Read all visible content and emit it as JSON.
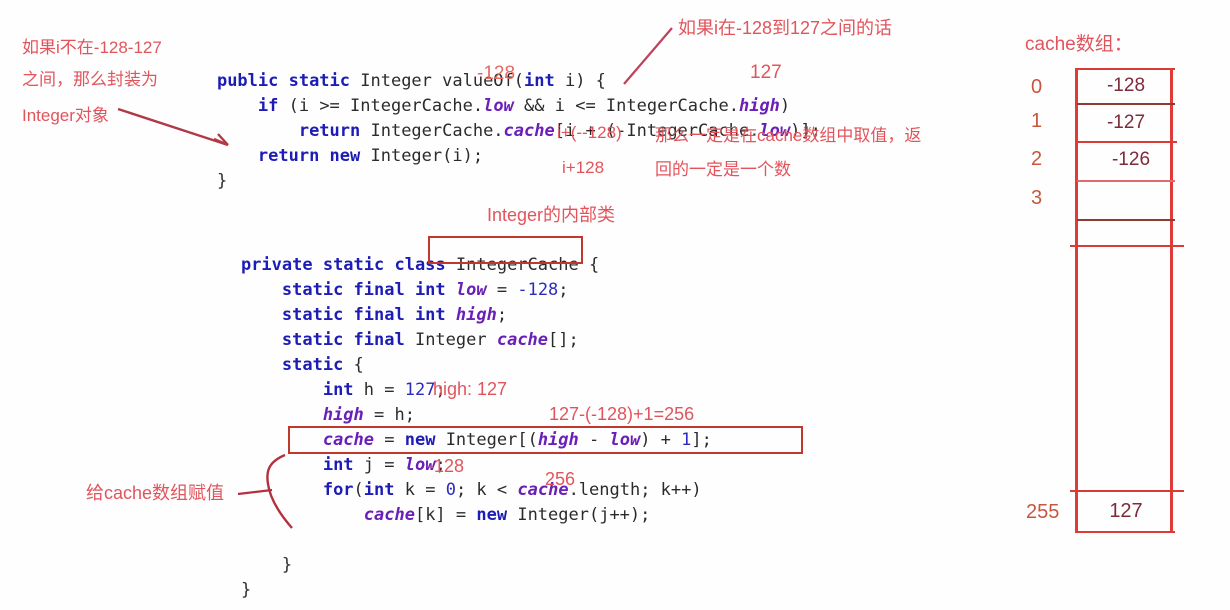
{
  "code_top": {
    "lines": [
      [
        {
          "t": "    ",
          "c": "plain"
        },
        {
          "t": "public static ",
          "c": "kw"
        },
        {
          "t": "Integer valueOf(",
          "c": "plain"
        },
        {
          "t": "int",
          "c": "kw"
        },
        {
          "t": " i) {",
          "c": "plain"
        }
      ],
      [
        {
          "t": "        ",
          "c": "plain"
        },
        {
          "t": "if",
          "c": "kw"
        },
        {
          "t": " (i >= IntegerCache.",
          "c": "plain"
        },
        {
          "t": "low",
          "c": "field"
        },
        {
          "t": " && i <= IntegerCache.",
          "c": "plain"
        },
        {
          "t": "high",
          "c": "field"
        },
        {
          "t": ")",
          "c": "plain"
        }
      ],
      [
        {
          "t": "            ",
          "c": "plain"
        },
        {
          "t": "return",
          "c": "kw"
        },
        {
          "t": " IntegerCache.",
          "c": "plain"
        },
        {
          "t": "cache",
          "c": "field"
        },
        {
          "t": "[i + (-IntegerCache.",
          "c": "plain"
        },
        {
          "t": "low",
          "c": "field"
        },
        {
          "t": ")];",
          "c": "plain"
        }
      ],
      [
        {
          "t": "        ",
          "c": "plain"
        },
        {
          "t": "return new",
          "c": "kw"
        },
        {
          "t": " Integer(i);",
          "c": "plain"
        }
      ],
      [
        {
          "t": "    }",
          "c": "plain"
        }
      ]
    ]
  },
  "code_middle": {
    "lines": [
      [
        {
          "t": "    ",
          "c": "plain"
        },
        {
          "t": "private static class",
          "c": "kw"
        },
        {
          "t": " IntegerCache {",
          "c": "plain"
        }
      ],
      [
        {
          "t": "        ",
          "c": "plain"
        },
        {
          "t": "static final int",
          "c": "kw"
        },
        {
          "t": " ",
          "c": "plain"
        },
        {
          "t": "low",
          "c": "field"
        },
        {
          "t": " = ",
          "c": "plain"
        },
        {
          "t": "-128",
          "c": "num"
        },
        {
          "t": ";",
          "c": "plain"
        }
      ],
      [
        {
          "t": "        ",
          "c": "plain"
        },
        {
          "t": "static final int",
          "c": "kw"
        },
        {
          "t": " ",
          "c": "plain"
        },
        {
          "t": "high",
          "c": "field"
        },
        {
          "t": ";",
          "c": "plain"
        }
      ],
      [
        {
          "t": "        ",
          "c": "plain"
        },
        {
          "t": "static final",
          "c": "kw"
        },
        {
          "t": " Integer ",
          "c": "plain"
        },
        {
          "t": "cache",
          "c": "field"
        },
        {
          "t": "[];",
          "c": "plain"
        }
      ],
      [
        {
          "t": "        ",
          "c": "plain"
        },
        {
          "t": "static",
          "c": "kw"
        },
        {
          "t": " {",
          "c": "plain"
        }
      ],
      [
        {
          "t": "            ",
          "c": "plain"
        },
        {
          "t": "int",
          "c": "kw"
        },
        {
          "t": " h = ",
          "c": "plain"
        },
        {
          "t": "127",
          "c": "num"
        },
        {
          "t": ";",
          "c": "plain"
        }
      ],
      [
        {
          "t": "            ",
          "c": "plain"
        },
        {
          "t": "high",
          "c": "field"
        },
        {
          "t": " = h;",
          "c": "plain"
        }
      ],
      [
        {
          "t": "            ",
          "c": "plain"
        },
        {
          "t": "cache",
          "c": "field"
        },
        {
          "t": " = ",
          "c": "plain"
        },
        {
          "t": "new",
          "c": "kw"
        },
        {
          "t": " Integer[(",
          "c": "plain"
        },
        {
          "t": "high",
          "c": "field"
        },
        {
          "t": " - ",
          "c": "plain"
        },
        {
          "t": "low",
          "c": "field"
        },
        {
          "t": ") + ",
          "c": "plain"
        },
        {
          "t": "1",
          "c": "num"
        },
        {
          "t": "];",
          "c": "plain"
        }
      ],
      [
        {
          "t": "            ",
          "c": "plain"
        },
        {
          "t": "int",
          "c": "kw"
        },
        {
          "t": " j = ",
          "c": "plain"
        },
        {
          "t": "low",
          "c": "field"
        },
        {
          "t": ";",
          "c": "plain"
        }
      ],
      [
        {
          "t": "            ",
          "c": "plain"
        },
        {
          "t": "for",
          "c": "kw"
        },
        {
          "t": "(",
          "c": "plain"
        },
        {
          "t": "int",
          "c": "kw"
        },
        {
          "t": " k = ",
          "c": "plain"
        },
        {
          "t": "0",
          "c": "num"
        },
        {
          "t": "; k < ",
          "c": "plain"
        },
        {
          "t": "cache",
          "c": "field"
        },
        {
          "t": ".length; k++)",
          "c": "plain"
        }
      ],
      [
        {
          "t": "                ",
          "c": "plain"
        },
        {
          "t": "cache",
          "c": "field"
        },
        {
          "t": "[k] = ",
          "c": "plain"
        },
        {
          "t": "new",
          "c": "kw"
        },
        {
          "t": " Integer(j++);",
          "c": "plain"
        }
      ],
      [
        {
          "t": "",
          "c": "plain"
        }
      ],
      [
        {
          "t": "        }",
          "c": "plain"
        }
      ],
      [
        {
          "t": "    }",
          "c": "plain"
        }
      ]
    ]
  },
  "annotations": {
    "left_note_line1": "如果i不在-128-127",
    "left_note_line2": "之间，那么封装为",
    "left_note_line3": "Integer对象",
    "top_note": "如果i在-128到127之间的话",
    "low_value_top": "-128",
    "high_value_top": "127",
    "index_expr_1": "i+(--128)",
    "index_expr_2": "i+128",
    "return_note_line1": "那么一定是在cache数组中取值，返",
    "return_note_line2": "回的一定是一个数",
    "inner_class_note": "Integer的内部类",
    "high_note": "high: 127",
    "size_calc": "127-(-128)+1=256",
    "low_value_j": "-128",
    "length_value": "256",
    "assign_note": "给cache数组赋值"
  },
  "cache_array": {
    "title": "cache数组：",
    "indices": [
      "0",
      "1",
      "2",
      "3",
      "255"
    ],
    "values": [
      "-128",
      "-127",
      "-126",
      "",
      "127"
    ]
  },
  "watermark": {
    "text": ""
  },
  "colors": {
    "annotation": "#e2545c",
    "box_border": "#c0392b",
    "table_border": "#e03b37",
    "keyword": "#1d1db5",
    "field": "#6a1fb8",
    "number": "#2b2bc0"
  }
}
